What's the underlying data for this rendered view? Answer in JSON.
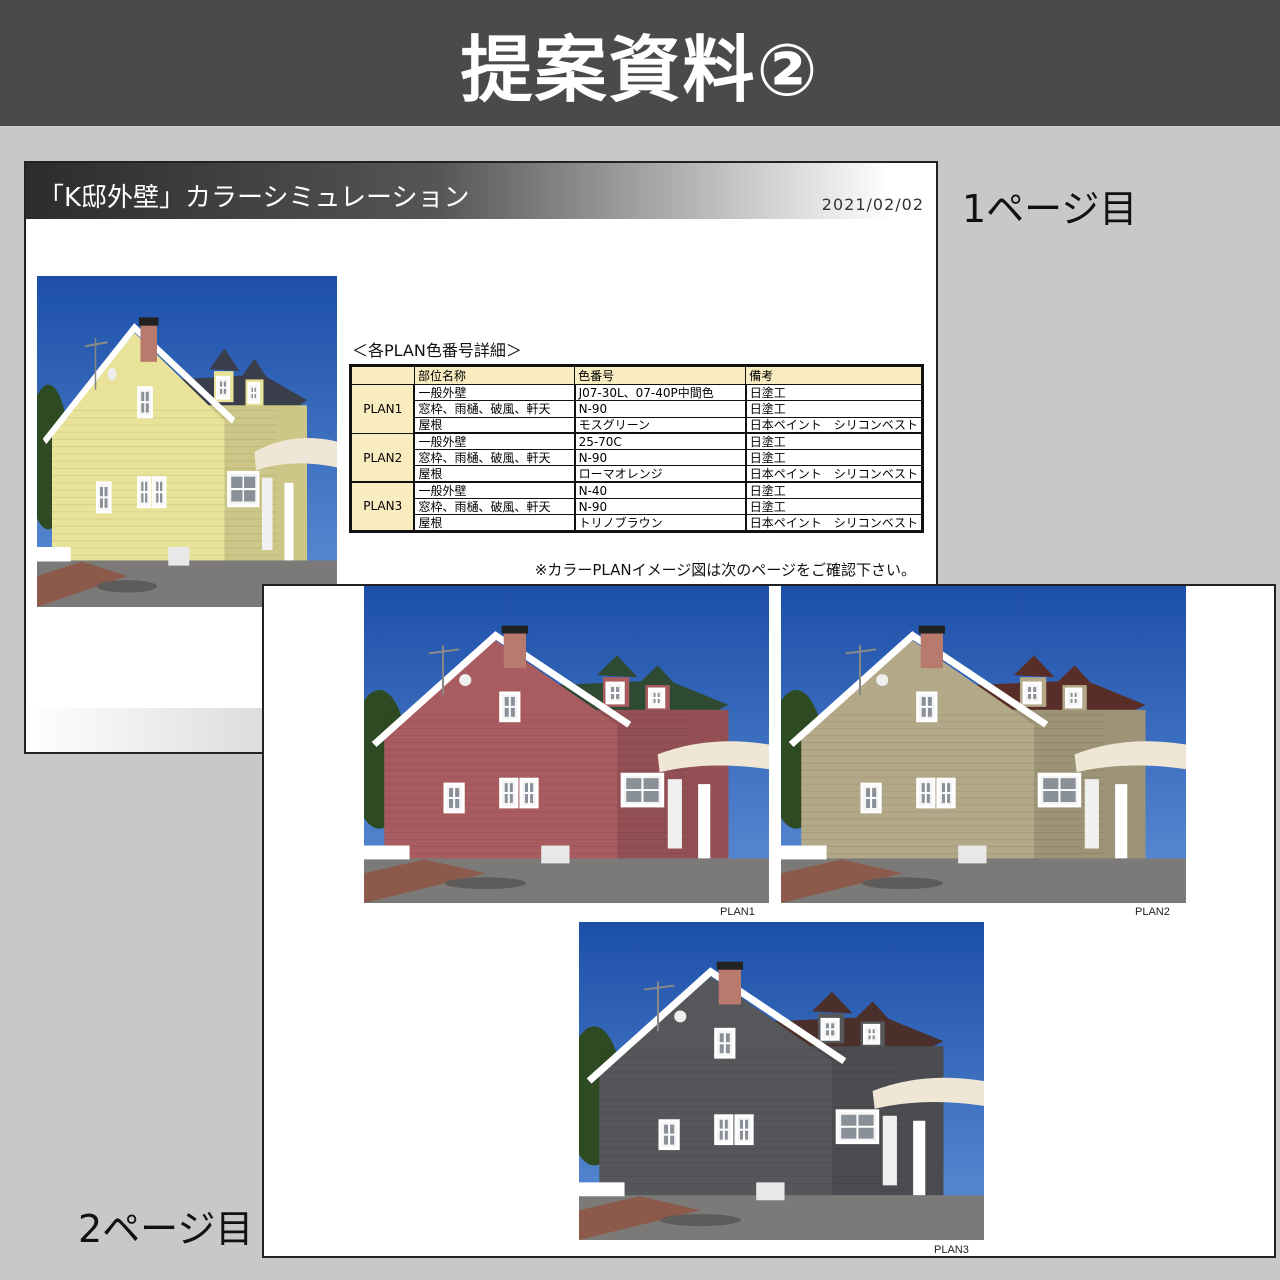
{
  "banner": {
    "title": "提案資料②"
  },
  "labels": {
    "page1": "1ページ目",
    "page2": "2ページ目"
  },
  "page1": {
    "title": "「K邸外壁」カラーシミュレーション",
    "date": "2021/02/02",
    "table_heading": "＜各PLAN色番号詳細＞",
    "columns": [
      "部位名称",
      "色番号",
      "備考"
    ],
    "plans": [
      {
        "name": "PLAN1",
        "rows": [
          [
            "一般外壁",
            "J07-30L、07-40P中間色",
            "日塗工"
          ],
          [
            "窓枠、雨樋、破風、軒天",
            "N-90",
            "日塗工"
          ],
          [
            "屋根",
            "モスグリーン",
            "日本ペイント　シリコンベスト"
          ]
        ]
      },
      {
        "name": "PLAN2",
        "rows": [
          [
            "一般外壁",
            "25-70C",
            "日塗工"
          ],
          [
            "窓枠、雨樋、破風、軒天",
            "N-90",
            "日塗工"
          ],
          [
            "屋根",
            "ローマオレンジ",
            "日本ペイント　シリコンベスト"
          ]
        ]
      },
      {
        "name": "PLAN3",
        "rows": [
          [
            "一般外壁",
            "N-40",
            "日塗工"
          ],
          [
            "窓枠、雨樋、破風、軒天",
            "N-90",
            "日塗工"
          ],
          [
            "屋根",
            "トリノブラウン",
            "日本ペイント　シリコンベスト"
          ]
        ]
      }
    ],
    "note": "※カラーPLANイメージ図は次のページをご確認下さい。"
  },
  "page2": {
    "captions": [
      "PLAN1",
      "PLAN2",
      "PLAN3"
    ]
  },
  "colors": {
    "original_wall": "#e9e39a",
    "plan1_wall": "#a85c60",
    "plan2_wall": "#b3a888",
    "plan3_wall": "#55575a",
    "plan1_roof": "#2f4a33",
    "plan2_roof": "#5a2e28",
    "plan3_roof": "#4a2f2a",
    "original_roof": "#3a3d4a"
  }
}
